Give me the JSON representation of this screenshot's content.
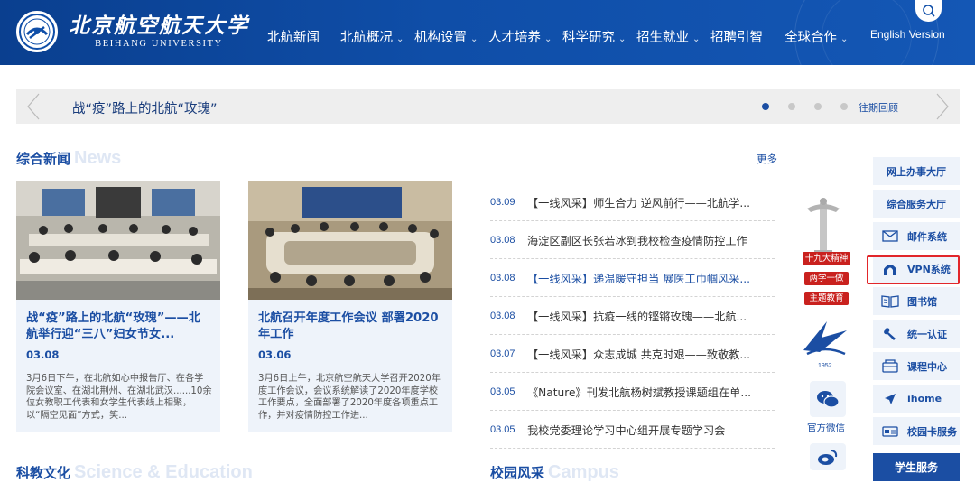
{
  "header": {
    "logo_cn": "北京航空航天大学",
    "logo_en": "BEIHANG UNIVERSITY",
    "nav": [
      {
        "label": "北航新闻",
        "dropdown": false
      },
      {
        "label": "北航概况",
        "dropdown": true
      },
      {
        "label": "机构设置",
        "dropdown": true
      },
      {
        "label": "人才培养",
        "dropdown": true
      },
      {
        "label": "科学研究",
        "dropdown": true
      },
      {
        "label": "招生就业",
        "dropdown": true
      },
      {
        "label": "招聘引智",
        "dropdown": false
      },
      {
        "label": "全球合作",
        "dropdown": true
      }
    ],
    "chevron": "⌄",
    "english_version": "English Version"
  },
  "banner": {
    "text": "战“疫”路上的北航“玫瑰”",
    "archive_label": "往期回顾",
    "dots": 4,
    "active_dot": 0
  },
  "news": {
    "title_cn": "综合新闻",
    "title_en": "News",
    "more": "更多",
    "cards": [
      {
        "title": "战“疫”路上的北航“玫瑰”——北航举行迎“三八”妇女节女...",
        "date": "03.08",
        "desc": "3月6日下午，在北航如心中报告厅、在各学院会议室、在湖北荆州、在湖北武汉......10余位女教职工代表和女学生代表线上相聚，以“隔空见面”方式，笑..."
      },
      {
        "title": "北航召开年度工作会议 部署2020年工作",
        "date": "03.06",
        "desc": "3月6日上午，北京航空航天大学召开2020年度工作会议，会议系统解读了2020年度学校工作要点，全面部署了2020年度各项重点工作，并对疫情防控工作进..."
      }
    ],
    "list": [
      {
        "date": "03.09",
        "title": "【一线风采】师生合力 逆风前行——北航学...",
        "hover": false
      },
      {
        "date": "03.08",
        "title": "海淀区副区长张若冰到我校检查疫情防控工作",
        "hover": false
      },
      {
        "date": "03.08",
        "title": "【一线风采】递温暖守担当 展医工巾帼风采...",
        "hover": true
      },
      {
        "date": "03.08",
        "title": "【一线风采】抗疫一线的铿锵玫瑰——北航...",
        "hover": false
      },
      {
        "date": "03.07",
        "title": "【一线风采】众志成城 共克时艰——致敬教...",
        "hover": false
      },
      {
        "date": "03.05",
        "title": "《Nature》刊发北航杨树斌教授课题组在单...",
        "hover": false
      },
      {
        "date": "03.05",
        "title": "我校党委理论学习中心组开展专题学习会",
        "hover": false
      }
    ]
  },
  "promo": {
    "tags": [
      "十九大精神",
      "两学一做",
      "主题教育"
    ],
    "emblem_year": "1952",
    "wechat_label": "官方微信"
  },
  "services": [
    {
      "label": "网上办事大厅",
      "icon": "",
      "style": "plain"
    },
    {
      "label": "综合服务大厅",
      "icon": "",
      "style": "plain"
    },
    {
      "label": "邮件系统",
      "icon": "mail-icon",
      "style": "icon"
    },
    {
      "label": "VPN系统",
      "icon": "vpn-icon",
      "style": "icon"
    },
    {
      "label": "图书馆",
      "icon": "book-icon",
      "style": "icon"
    },
    {
      "label": "统一认证",
      "icon": "wrench-icon",
      "style": "icon"
    },
    {
      "label": "课程中心",
      "icon": "course-icon",
      "style": "icon"
    },
    {
      "label": "ihome",
      "icon": "send-icon",
      "style": "icon"
    },
    {
      "label": "校园卡服务",
      "icon": "card-icon",
      "style": "icon"
    },
    {
      "label": "学生服务",
      "icon": "",
      "style": "hot"
    }
  ],
  "bottom_peeks": [
    {
      "cn": "科教文化",
      "en": "Science & Education"
    },
    {
      "cn": "校园风采",
      "en": "Campus"
    }
  ],
  "colors": {
    "header_blue": "#0f4ea8",
    "accent_blue": "#1b4ea3",
    "light_panel": "#eef3fa",
    "highlight_red": "#e2262a"
  }
}
